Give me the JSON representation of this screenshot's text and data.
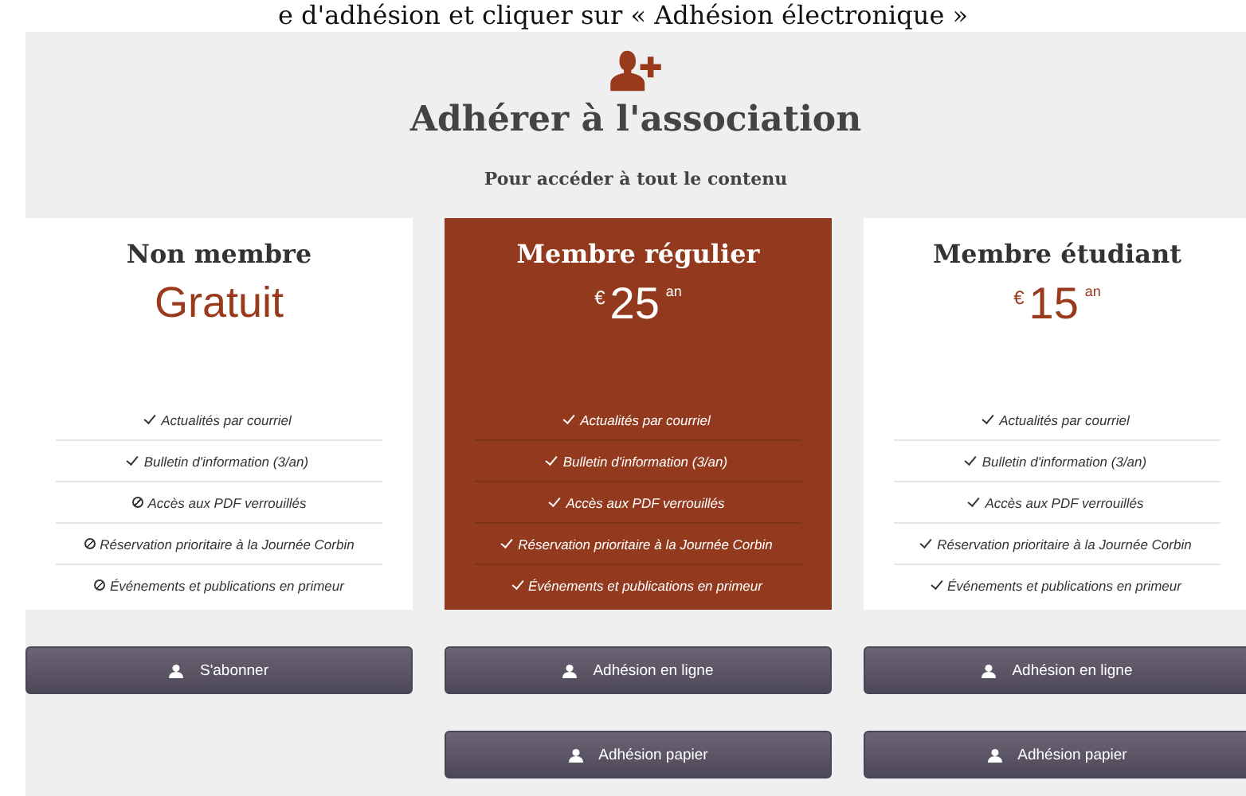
{
  "intro_text": "e d'adhésion et cliquer sur « Adhésion électronique »",
  "section": {
    "title": "Adhérer à l'association",
    "subtitle": "Pour accéder à tout le contenu"
  },
  "plans": [
    {
      "name": "Non membre",
      "selected": false,
      "price": {
        "kind": "text",
        "text": "Gratuit"
      },
      "features": [
        {
          "label": "Actualités par courriel",
          "included": true
        },
        {
          "label": "Bulletin d'information (3/an)",
          "included": true
        },
        {
          "label": "Accès aux PDF verrouillés",
          "included": false
        },
        {
          "label": "Réservation prioritaire à la Journée Corbin",
          "included": false
        },
        {
          "label": "Événements et publications en primeur",
          "included": false
        }
      ],
      "buttons": [
        "S'abonner"
      ]
    },
    {
      "name": "Membre régulier",
      "selected": true,
      "price": {
        "kind": "amount",
        "currency": "€",
        "amount": "25",
        "period": "an"
      },
      "features": [
        {
          "label": "Actualités par courriel",
          "included": true
        },
        {
          "label": "Bulletin d'information (3/an)",
          "included": true
        },
        {
          "label": "Accès aux PDF verrouillés",
          "included": true
        },
        {
          "label": "Réservation prioritaire à la Journée Corbin",
          "included": true
        },
        {
          "label": "Événements et publications en primeur",
          "included": true
        }
      ],
      "buttons": [
        "Adhésion en ligne",
        "Adhésion papier"
      ]
    },
    {
      "name": "Membre étudiant",
      "selected": false,
      "price": {
        "kind": "amount",
        "currency": "€",
        "amount": "15",
        "period": "an"
      },
      "features": [
        {
          "label": "Actualités par courriel",
          "included": true
        },
        {
          "label": "Bulletin d'information (3/an)",
          "included": true
        },
        {
          "label": "Accès aux PDF verrouillés",
          "included": true
        },
        {
          "label": "Réservation prioritaire à la Journée Corbin",
          "included": true
        },
        {
          "label": "Événements et publications en primeur",
          "included": true
        }
      ],
      "buttons": [
        "Adhésion en ligne",
        "Adhésion papier"
      ]
    }
  ]
}
